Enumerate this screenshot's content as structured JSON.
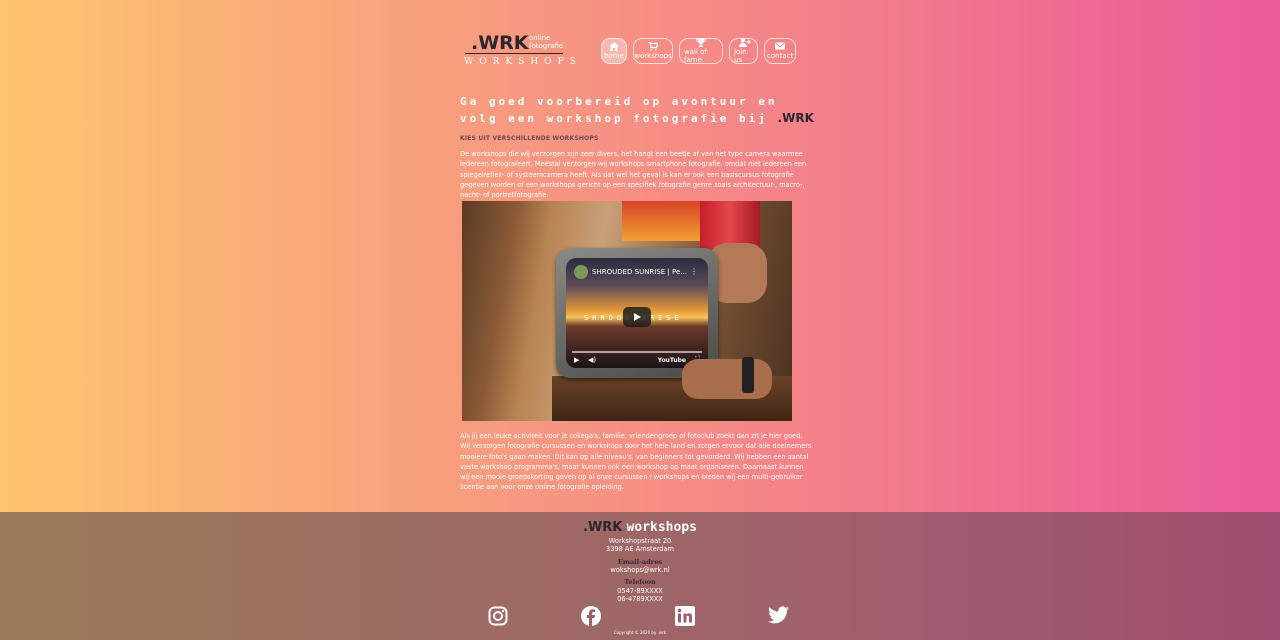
{
  "logo": {
    "brand": ".WRK",
    "sub_line1": "online",
    "sub_line2": "fotografie",
    "workshops": "WORKSHOPS"
  },
  "nav": {
    "items": [
      {
        "label": "home",
        "icon": "home-icon",
        "active": true
      },
      {
        "label": "workshops",
        "icon": "cart-icon",
        "active": false
      },
      {
        "label": "wall of fame",
        "icon": "trophy-icon",
        "active": false
      },
      {
        "label": "join us",
        "icon": "user-plus-icon",
        "active": false
      },
      {
        "label": "contact",
        "icon": "envelope-icon",
        "active": false
      }
    ]
  },
  "main": {
    "headline": "Ga goed voorbereid op avontuur en volg een workshop fotografie bij",
    "headline_brand": ".WRK",
    "subhead": "KIES UIT VERSCHILLENDE WORKSHOPS",
    "para1": "De workshops die wij verzorgen zijn zeer divers, het hangt een beetje af van het type camera waarmee iedereen fotografeert. Meestal verzorgen wij workshops smartphone fotografie, omdat niet iedereen een spiegelreflex- of systeemcamera heeft. Als dat wel het geval is kan er ook een basiscursus fotografie gegeven worden of een workshops gericht op een specifiek fotografie genre zoals architectuur-, macro-, nacht- of portretfotografie.",
    "video": {
      "title": "SHROUDED SUNRISE | Pe...",
      "watermark": "SHROUD   NRISE",
      "youtube": "YouTube"
    },
    "para2": "Als jij een leuke activiteit voor je collega's, familie, vriendengroep of fotoclub zoekt dan zit je hier goed. Wij verzorgen fotografie cursussen en workshops door het hele land en zorgen ervoor dat alle deelnemers mooiere foto's gaan maken. Dit kan op alle niveau's, van beginners tot gevorderd. Wij hebben een aantal vaste workshop programma's, maar kunnen ook een workshop op maat organiseren. Daarnaast kunnen wij een mooie groepskorting geven op al onze cursussen / workshops en bieden wij een multi-gebruiker licentie aan voor onze online fotografie opleiding."
  },
  "footer": {
    "brand1": ".WRK",
    "brand2": "workshops",
    "address1": "Workshopstraat 20",
    "address2": "3398 AE Amsterdam",
    "email_label": "Email-adres",
    "email": "wokshops@wrk.nl",
    "phone_label": "Telefoon",
    "phone1": "0547-89XXXX",
    "phone2": "06-4789XXXX",
    "socials": [
      "instagram-icon",
      "facebook-icon",
      "linkedin-icon",
      "twitter-icon"
    ],
    "copyright": "Copyright © 2020 by .wrk"
  }
}
